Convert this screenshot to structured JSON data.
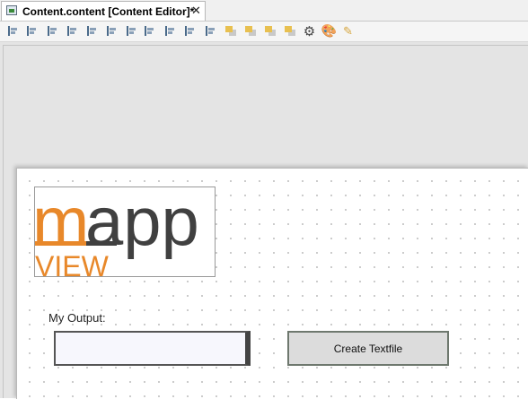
{
  "editor_tab": {
    "title": "Content.content [Content Editor]*",
    "close_glyph": "✕",
    "icon": "content-file-icon"
  },
  "toolbar": {
    "tools": [
      {
        "name": "align-left-icon",
        "glyph": ""
      },
      {
        "name": "align-top-icon",
        "glyph": ""
      },
      {
        "name": "align-right-icon",
        "glyph": ""
      },
      {
        "name": "align-bottom-icon",
        "glyph": ""
      },
      {
        "name": "center-vertical-icon",
        "glyph": ""
      },
      {
        "name": "center-horizontal-icon",
        "glyph": ""
      },
      {
        "name": "same-height-icon",
        "glyph": ""
      },
      {
        "name": "same-width-icon",
        "glyph": ""
      },
      {
        "name": "same-size-icon",
        "glyph": ""
      },
      {
        "name": "distribute-vertical-icon",
        "glyph": ""
      },
      {
        "name": "distribute-horizontal-icon",
        "glyph": ""
      },
      {
        "name": "bring-to-front-icon",
        "glyph": ""
      },
      {
        "name": "send-to-back-icon",
        "glyph": ""
      },
      {
        "name": "bring-forward-icon",
        "glyph": ""
      },
      {
        "name": "send-backward-icon",
        "glyph": ""
      },
      {
        "name": "gear-icon",
        "glyph": "⚙"
      },
      {
        "name": "palette-icon",
        "glyph": "🎨"
      },
      {
        "name": "format-brush-icon",
        "glyph": "✎"
      }
    ]
  },
  "logo": {
    "text_m": "m",
    "text_app": "app",
    "text_view": "VIEW"
  },
  "form": {
    "output_label": "My Output:",
    "output_value": "",
    "create_button_label": "Create Textfile"
  }
}
